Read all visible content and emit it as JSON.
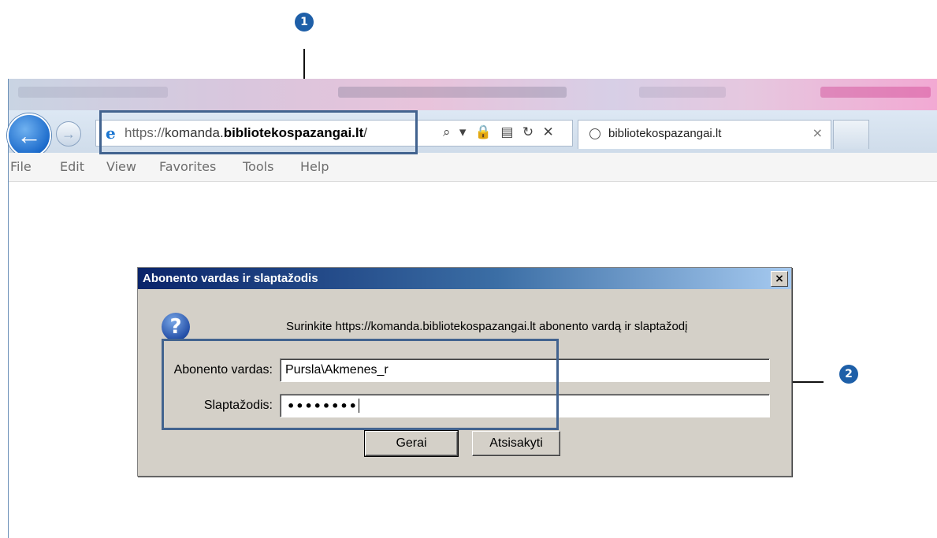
{
  "callouts": [
    "1",
    "2"
  ],
  "browser": {
    "url": {
      "scheme": "https://",
      "subdomain": "komanda.",
      "domain": "bibliotekospazangai.lt",
      "path": "/"
    },
    "address_icons": "⌕ ▾ 🔒 ▤ ↻ ✕",
    "tab_title": "bibliotekospazangai.lt",
    "tab_close": "×",
    "menu": [
      "File",
      "Edit",
      "View",
      "Favorites",
      "Tools",
      "Help"
    ]
  },
  "dialog": {
    "title": "Abonento vardas ir slaptažodis",
    "close": "×",
    "message": "Surinkite https://komanda.bibliotekospazangai.lt abonento vardą ir slaptažodį",
    "username_label": "Abonento vardas:",
    "username_value": "Pursla\\Akmenes_r",
    "password_label": "Slaptažodis:",
    "password_mask": "••••••••",
    "ok_label": "Gerai",
    "cancel_label": "Atsisakyti"
  },
  "colors": {
    "callout": "#1e5fa8",
    "highlight_box": "#42638f",
    "dialog_face": "#d4d0c8",
    "dialog_title": "#0a246a"
  }
}
